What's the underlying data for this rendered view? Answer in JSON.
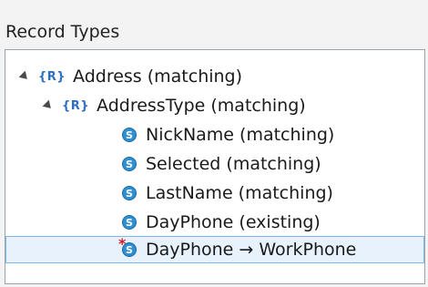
{
  "panel_title": "Record Types",
  "tree": [
    {
      "label": "Address (matching)",
      "icon": "R"
    },
    {
      "label": "AddressType (matching)",
      "icon": "R"
    },
    {
      "label": "NickName (matching)",
      "icon": "S"
    },
    {
      "label": "Selected (matching)",
      "icon": "S"
    },
    {
      "label": "LastName (matching)",
      "icon": "S"
    },
    {
      "label": "DayPhone (existing)",
      "icon": "S"
    },
    {
      "label": "DayPhone → WorkPhone",
      "icon": "S"
    }
  ],
  "icon_text": {
    "record": "{R}",
    "simple": "S"
  }
}
